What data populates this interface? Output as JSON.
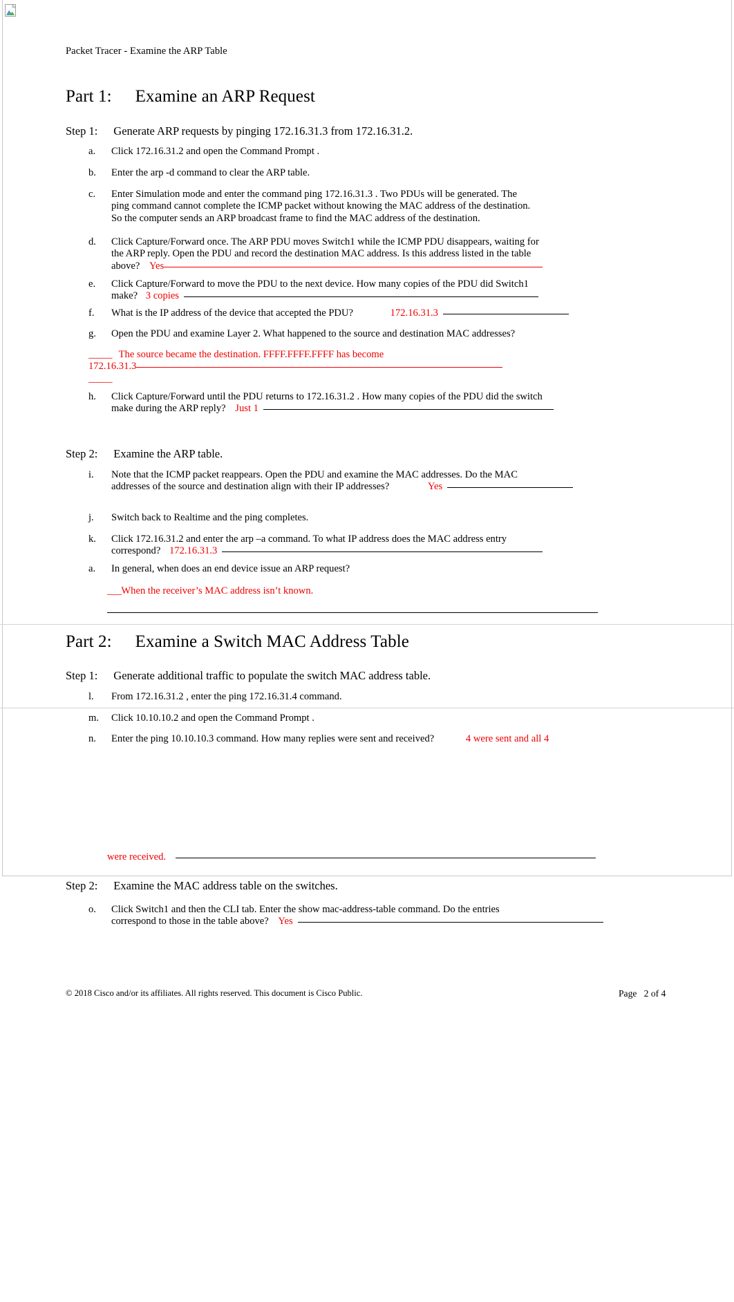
{
  "document": {
    "header": "Packet Tracer - Examine the ARP Table",
    "footer_left": "© 2018 Cisco and/or its affiliates. All rights reserved. This document is Cisco Public.",
    "footer_right": "Page   2 of 4",
    "broken_image_icon": "broken-image-icon"
  },
  "part1": {
    "label": "Part 1:",
    "title": "Examine an ARP Request",
    "step1": {
      "label": "Step 1:",
      "title": "Generate ARP requests by pinging 172.16.31.3 from 172.16.31.2.",
      "items": [
        {
          "marker": "a.",
          "text_1": "Click 172.16.31.2   and open the   Command Prompt     ."
        },
        {
          "marker": "b.",
          "text_1": "Enter the   arp -d   command to clear the ARP table."
        },
        {
          "marker": "c.",
          "text_1": "Enter  Simulation     mode and enter the command        ping 172.16.31.3   . Two PDUs will be generated. The",
          "text_2": "ping  command cannot complete the ICMP packet without knowing the MAC address of the destination.",
          "text_3": "So the computer sends an ARP broadcast frame to find the MAC address of the destination."
        },
        {
          "marker": "d.",
          "text_1": "Click Capture/Forward     once. The ARP PDU moves     Switch1   while the ICMP PDU disappears, waiting for",
          "text_2": "the ARP reply. Open the PDU and record the destination MAC address. Is this address listed in the table",
          "text_3": "above?",
          "answer": "Yes"
        },
        {
          "marker": "e.",
          "text_1": "Click Capture/Forward     to move the PDU to the next device. How many copies of the PDU did        Switch1",
          "text_2": "make?",
          "answer": "3 copies"
        },
        {
          "marker": "f.",
          "text_1": "What is the IP address of the device that accepted the PDU?",
          "answer": "172.16.31.3"
        },
        {
          "marker": "g.",
          "text_1": "Open the PDU and examine Layer 2. What happened to the source and destination MAC addresses?",
          "answer_line1_blank": "_____",
          "answer_line1": "The source became the destination. FFFF.FFFF.FFFF has become",
          "answer_line2": "172.16.31.3",
          "answer_line3_blank": "_____"
        },
        {
          "marker": "h.",
          "text_1": "Click Capture/Forward     until the PDU returns to    172.16.31.2  . How many copies of the PDU did the switch",
          "text_2": "make during the ARP reply?",
          "answer": "Just 1"
        }
      ]
    },
    "step2": {
      "label": "Step 2:",
      "title": "Examine the ARP table.",
      "items": [
        {
          "marker": "i.",
          "text_1": "Note that the ICMP packet reappears. Open the PDU and examine the MAC addresses. Do the MAC",
          "text_2": "addresses of the source and destination align with their IP addresses?",
          "answer": "Yes"
        },
        {
          "marker": "j.",
          "text_1": "Switch back to    Realtime   and the ping completes."
        },
        {
          "marker": "k.",
          "text_1": "Click 172.16.31.2   and enter the    arp –a   command. To what IP address does the MAC address entry",
          "text_2": "correspond?",
          "answer": "172.16.31.3"
        },
        {
          "marker": "a.",
          "text_1": "In general, when does an end device issue an ARP request?",
          "answer_blank": "___",
          "answer": "When the receiver’s MAC address isn’t known."
        }
      ]
    }
  },
  "part2": {
    "label": "Part 2:",
    "title": "Examine a Switch MAC Address Table",
    "step1": {
      "label": "Step 1:",
      "title": "Generate additional traffic to populate the switch MAC address table.",
      "items": [
        {
          "marker": "l.",
          "text_1": "From  172.16.31.2  , enter the   ping 172.16.31.4     command."
        },
        {
          "marker": "m.",
          "text_1": "Click 10.10.10.2   and open the   Command Prompt     ."
        },
        {
          "marker": "n.",
          "text_1": "Enter the   ping 10.10.10.3     command. How many replies were sent and received?",
          "answer": "4 were sent and all 4",
          "answer_cont": "were received."
        }
      ]
    },
    "step2": {
      "label": "Step 2:",
      "title": "Examine the MAC address table on the switches.",
      "items": [
        {
          "marker": "o.",
          "text_1": "Click Switch1   and then the    CLI tab. Enter the    show mac-address-table         command. Do the entries",
          "text_2": "correspond to those in the table above?",
          "answer": "Yes"
        }
      ]
    }
  },
  "colors": {
    "answer_red": "#ee0000",
    "text_black": "#000000",
    "page_border": "#c8c8c8"
  }
}
